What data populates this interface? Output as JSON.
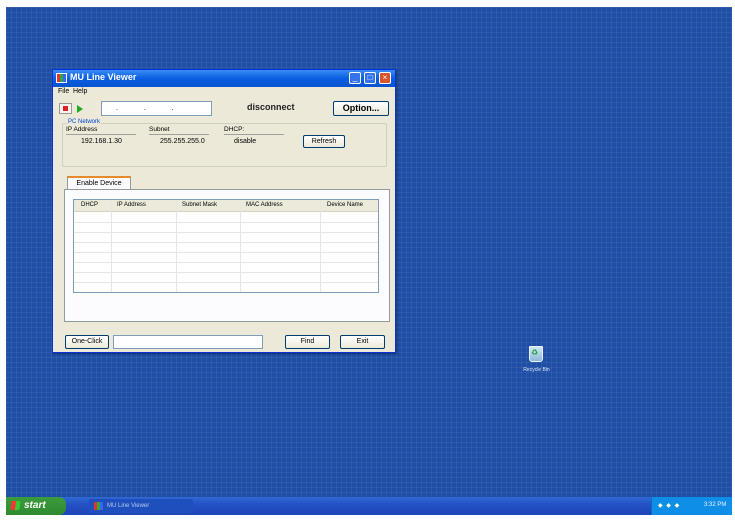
{
  "window": {
    "title": "MU Line Viewer",
    "menu": [
      "File",
      "Help"
    ],
    "toolbar": {
      "ip_placeholder": ".  .  .",
      "status": "disconnect",
      "option_label": "Option..."
    },
    "pc_network": {
      "legend": "PC Network",
      "ip_label": "IP Address",
      "ip_value": "192.168.1.30",
      "subnet_label": "Subnet",
      "subnet_value": "255.255.255.0",
      "dhcp_label": "DHCP:",
      "dhcp_value": "disable",
      "refresh_label": "Refresh"
    },
    "tab_label": "Enable Device",
    "table": {
      "columns": [
        "DHCP",
        "IP Address",
        "Subnet Mask",
        "MAC Address",
        "Device Name"
      ],
      "rows": []
    },
    "bottom": {
      "oneclick_label": "One-Click",
      "oneclick_value": "",
      "find_label": "Find",
      "exit_label": "Exit"
    }
  },
  "desktop": {
    "recycle_label": "Recycle Bin"
  },
  "taskbar": {
    "start_label": "start",
    "task_label": "MU Line Viewer",
    "clock": "3:32 PM"
  }
}
